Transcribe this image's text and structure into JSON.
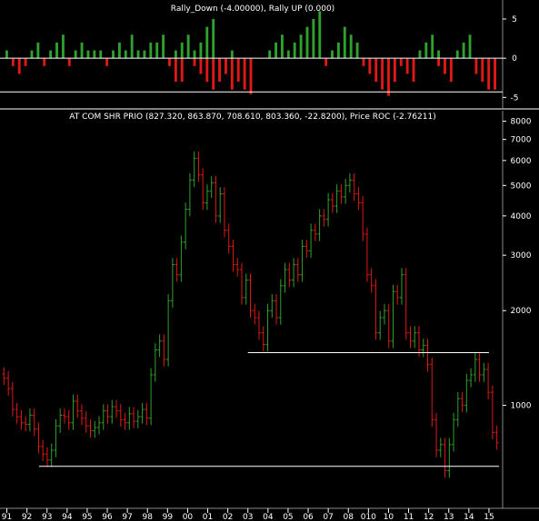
{
  "colors": {
    "background": "#000000",
    "text": "#ffffff",
    "bullish_bar": "#2ea12e",
    "bearish_bar": "#e01818",
    "support_line": "#ffffff"
  },
  "chart_data": [
    {
      "type": "bar",
      "title": "Rally_Down (-4.00000), Rally UP (0.000)",
      "ylim": [
        -6,
        6.5
      ],
      "yticks": [
        "5",
        "0",
        "-5"
      ],
      "ytick_values": [
        5,
        0,
        -5
      ],
      "reference_lines": [
        0,
        -4.3
      ],
      "series": [
        {
          "name": "Rally UP",
          "values": [
            1,
            0,
            0,
            0,
            1,
            2,
            0,
            1,
            2,
            3,
            0,
            1,
            2,
            1,
            1,
            1,
            0,
            1,
            2,
            1,
            3,
            1,
            1,
            2,
            2,
            3,
            0,
            1,
            2,
            3,
            1,
            2,
            4,
            5,
            0,
            0,
            1,
            0,
            0,
            0,
            0,
            0,
            1,
            2,
            3,
            1,
            2,
            3,
            4,
            5,
            6,
            0,
            1,
            2,
            4,
            3,
            2,
            0,
            0,
            0,
            0,
            0,
            0,
            0,
            0,
            0,
            1,
            2,
            3,
            1,
            0,
            0,
            1,
            2,
            3,
            0,
            0,
            0,
            0
          ]
        },
        {
          "name": "Rally_Down",
          "values": [
            0,
            -1,
            -2,
            -1,
            0,
            0,
            -1,
            0,
            0,
            0,
            -1,
            0,
            0,
            0,
            0,
            0,
            -1,
            0,
            0,
            0,
            0,
            0,
            0,
            0,
            0,
            0,
            -1,
            -3,
            -3,
            0,
            -1,
            -2,
            -3,
            -4,
            -3,
            -2,
            -4,
            -3,
            -4,
            -4.6,
            0,
            0,
            0,
            0,
            0,
            0,
            0,
            0,
            0,
            0,
            0,
            -1,
            0,
            0,
            0,
            0,
            0,
            -1,
            -2,
            -3,
            -4,
            -4.8,
            -3,
            -1,
            -2,
            -3,
            0,
            0,
            0,
            -1,
            -2,
            -3,
            0,
            0,
            0,
            -2,
            -3,
            -4,
            -4
          ]
        }
      ]
    },
    {
      "type": "ohlc",
      "title": "AT COM SHR PRIO (827.320, 863.870, 708.610, 803.360, -22.8200), Price ROC (-2.76211)",
      "y_scale": "log",
      "ylim": [
        480,
        8300
      ],
      "yticks": [
        "8000",
        "7000",
        "6000",
        "5000",
        "4000",
        "3000",
        "2000",
        "1000"
      ],
      "ytick_values": [
        8000,
        7000,
        6000,
        5000,
        4000,
        3000,
        2000,
        1000
      ],
      "xticks": [
        "91",
        "92",
        "93",
        "94",
        "95",
        "96",
        "97",
        "98",
        "99",
        "00",
        "01",
        "02",
        "03",
        "04",
        "05",
        "06",
        "07",
        "08",
        "010",
        "10",
        "11",
        "12",
        "13",
        "14",
        "15"
      ],
      "x_start": 1990.75,
      "x_end": 2015.5,
      "support_lines": [
        {
          "value": 1470,
          "from": 2003.0,
          "to": 2015.0
        },
        {
          "value": 640,
          "from": 1992.6,
          "to": 2015.5
        }
      ],
      "closes": [
        1220,
        1130,
        970,
        920,
        880,
        870,
        930,
        840,
        740,
        700,
        670,
        720,
        860,
        930,
        920,
        880,
        1030,
        960,
        910,
        860,
        830,
        850,
        880,
        960,
        920,
        990,
        960,
        900,
        880,
        940,
        890,
        920,
        970,
        910,
        1250,
        1500,
        1600,
        1400,
        2150,
        2800,
        2600,
        3300,
        4200,
        5200,
        6100,
        5400,
        4400,
        4800,
        5100,
        4000,
        4700,
        3600,
        3200,
        2800,
        2700,
        2200,
        2500,
        2000,
        1900,
        1700,
        1560,
        2000,
        2150,
        1900,
        2400,
        2700,
        2500,
        2800,
        2600,
        3200,
        3100,
        3600,
        3500,
        4000,
        3900,
        4500,
        4300,
        4800,
        4600,
        5000,
        5200,
        4700,
        4400,
        3500,
        2600,
        2400,
        1700,
        1900,
        2000,
        1600,
        2300,
        2200,
        2600,
        1700,
        1600,
        1700,
        1500,
        1550,
        1350,
        900,
        720,
        750,
        620,
        750,
        900,
        1050,
        1000,
        1200,
        1250,
        1400,
        1250,
        1300,
        1100,
        820,
        760
      ]
    }
  ]
}
